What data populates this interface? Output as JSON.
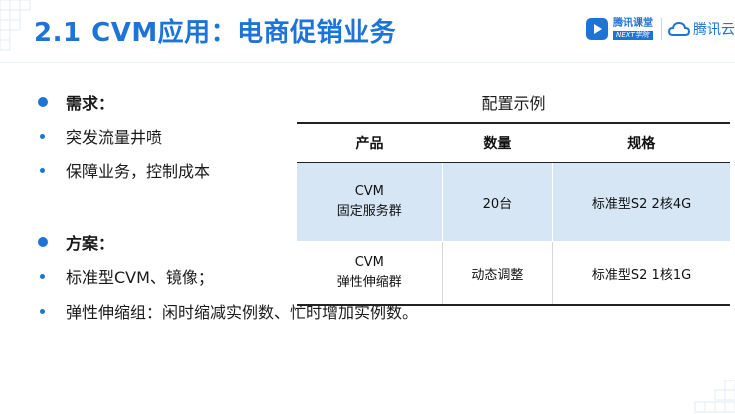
{
  "title": "2.1 CVM应用：电商促销业务",
  "logos": {
    "next_cn": "腾讯课堂",
    "next_en": "NEXT学院",
    "tencent_cloud": "腾讯云"
  },
  "left": {
    "section1_heading": "需求：",
    "section1_items": [
      "突发流量井喷",
      "保障业务，控制成本"
    ],
    "section2_heading": "方案：",
    "section2_items": [
      "标准型CVM、镜像；",
      "弹性伸缩组：闲时缩减实例数、忙时增加实例数。"
    ]
  },
  "table": {
    "caption": "配置示例",
    "headers": [
      "产品",
      "数量",
      "规格"
    ],
    "rows": [
      {
        "product_line1": "CVM",
        "product_line2": "固定服务群",
        "qty": "20台",
        "spec": "标准型S2 2核4G"
      },
      {
        "product_line1": "CVM",
        "product_line2": "弹性伸缩群",
        "qty": "动态调整",
        "spec": "标准型S2 1核1G"
      }
    ]
  },
  "colors": {
    "accent": "#1e74d6",
    "row_highlight": "#d6e6f5"
  }
}
